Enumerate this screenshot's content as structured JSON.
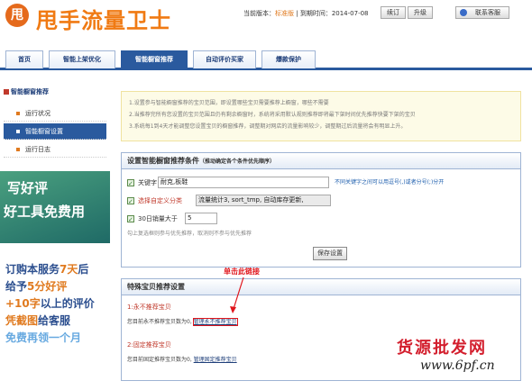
{
  "header": {
    "logo_glyph": "甩",
    "app_title": "甩手流量卫士",
    "version_label": "当前版本：",
    "edition": "标准版",
    "expiry_label": "| 到期时间：2014-07-08",
    "renew_label": "续订",
    "upgrade_label": "升级",
    "service_label": "联系客服",
    "accent_color": "#f07a13"
  },
  "nav": {
    "tabs": [
      {
        "label": "首页"
      },
      {
        "label": "智能上架优化"
      },
      {
        "label": "智能橱窗推荐"
      },
      {
        "label": "自动评价买家"
      },
      {
        "label": "爆款保护"
      }
    ]
  },
  "sidebar": {
    "heading": "智能橱窗推荐",
    "items": [
      {
        "label": "运行状况"
      },
      {
        "label": "智能橱窗设置"
      },
      {
        "label": "运行日志"
      }
    ]
  },
  "promo": {
    "line1": "写好评",
    "line2": "好工具免费用",
    "body": [
      {
        "pre": "订购本服务",
        "hl": "7天",
        "post": "后"
      },
      {
        "pre": "给予",
        "hl": "5分好评",
        "post": ""
      },
      {
        "pre": "",
        "hl": "+10字",
        "post": "以上的评价"
      },
      {
        "pre": "凭截图",
        "hl": "",
        "post": "给客服"
      },
      {
        "pre": "免费再领一个月",
        "hl": "",
        "post": ""
      }
    ]
  },
  "notice": {
    "lines": [
      "1.设置参与智能橱窗推荐的宝贝范围，即设置哪些宝贝需要推荐上橱窗，哪些不需要",
      "2.当推荐完所有您设置的宝贝范围且仍有剩余橱窗时，系统将采用默认规则推荐即将最下架时间优先推荐快要下架的宝贝",
      "3.系统每1到4天才能调整您设置宝贝的橱窗推荐，调整期对网店的流量影响较少，调整期过后流量将会有明显上升。"
    ]
  },
  "conditions": {
    "title": "设置智能橱窗推荐条件",
    "subtitle": "（推动确定各个条件优先顺序）",
    "keyword_label": "关键字",
    "keyword_value": "耐克,板鞋",
    "keyword_hint": "不同关键字之间可以用逗号(,)或者分号(;)分开",
    "category_label": "选择自定义分类",
    "category_value": "流量统计3, sort_tmp, 自动库存更新,",
    "sales_label": "30日销量大于",
    "sales_value": "5",
    "footer_hint": "勾上复选框则参与优先推荐，取消则不参与优先推荐",
    "save_label": "保存设置"
  },
  "special": {
    "title": "特殊宝贝推荐设置",
    "never_title": "1:永不推荐宝贝",
    "never_text": "您目前永不推荐宝贝数为0,",
    "never_link": "管理永不推荐宝贝",
    "fixed_title": "2:固定推荐宝贝",
    "fixed_text": "您目前固定推荐宝贝数为0,",
    "fixed_link": "管理固定推荐宝贝"
  },
  "annotation": {
    "text": "单击此链接",
    "color": "#e0151b"
  },
  "watermark": {
    "title": "货源批发网",
    "url": "www.6pf.cn"
  }
}
